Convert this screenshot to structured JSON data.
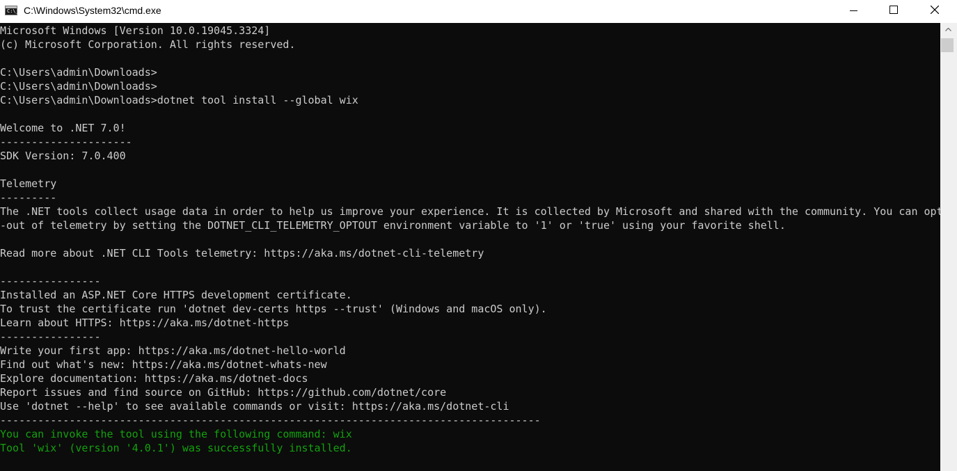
{
  "window": {
    "title": "C:\\Windows\\System32\\cmd.exe",
    "icon": "cmd-icon",
    "icon_prompt": "C:\\_"
  },
  "console": {
    "text_color": "#cccccc",
    "success_color": "#13a10e",
    "background": "#0c0c0c",
    "lines": [
      {
        "text": "Microsoft Windows [Version 10.0.19045.3324]",
        "style": "normal"
      },
      {
        "text": "(c) Microsoft Corporation. All rights reserved.",
        "style": "normal"
      },
      {
        "text": "",
        "style": "normal"
      },
      {
        "text": "C:\\Users\\admin\\Downloads>",
        "style": "normal"
      },
      {
        "text": "C:\\Users\\admin\\Downloads>",
        "style": "normal"
      },
      {
        "text": "C:\\Users\\admin\\Downloads>dotnet tool install --global wix",
        "style": "normal"
      },
      {
        "text": "",
        "style": "normal"
      },
      {
        "text": "Welcome to .NET 7.0!",
        "style": "normal"
      },
      {
        "text": "---------------------",
        "style": "normal"
      },
      {
        "text": "SDK Version: 7.0.400",
        "style": "normal"
      },
      {
        "text": "",
        "style": "normal"
      },
      {
        "text": "Telemetry",
        "style": "normal"
      },
      {
        "text": "---------",
        "style": "normal"
      },
      {
        "text": "The .NET tools collect usage data in order to help us improve your experience. It is collected by Microsoft and shared with the community. You can opt",
        "style": "normal"
      },
      {
        "text": "-out of telemetry by setting the DOTNET_CLI_TELEMETRY_OPTOUT environment variable to '1' or 'true' using your favorite shell.",
        "style": "normal"
      },
      {
        "text": "",
        "style": "normal"
      },
      {
        "text": "Read more about .NET CLI Tools telemetry: https://aka.ms/dotnet-cli-telemetry",
        "style": "normal"
      },
      {
        "text": "",
        "style": "normal"
      },
      {
        "text": "----------------",
        "style": "normal"
      },
      {
        "text": "Installed an ASP.NET Core HTTPS development certificate.",
        "style": "normal"
      },
      {
        "text": "To trust the certificate run 'dotnet dev-certs https --trust' (Windows and macOS only).",
        "style": "normal"
      },
      {
        "text": "Learn about HTTPS: https://aka.ms/dotnet-https",
        "style": "normal"
      },
      {
        "text": "----------------",
        "style": "normal"
      },
      {
        "text": "Write your first app: https://aka.ms/dotnet-hello-world",
        "style": "normal"
      },
      {
        "text": "Find out what's new: https://aka.ms/dotnet-whats-new",
        "style": "normal"
      },
      {
        "text": "Explore documentation: https://aka.ms/dotnet-docs",
        "style": "normal"
      },
      {
        "text": "Report issues and find source on GitHub: https://github.com/dotnet/core",
        "style": "normal"
      },
      {
        "text": "Use 'dotnet --help' to see available commands or visit: https://aka.ms/dotnet-cli",
        "style": "normal"
      },
      {
        "text": "--------------------------------------------------------------------------------------",
        "style": "normal"
      },
      {
        "text": "You can invoke the tool using the following command: wix",
        "style": "green"
      },
      {
        "text": "Tool 'wix' (version '4.0.1') was successfully installed.",
        "style": "green"
      }
    ]
  },
  "controls": {
    "minimize_icon": "minimize-icon",
    "maximize_icon": "maximize-icon",
    "close_icon": "close-icon",
    "scroll_up_icon": "scroll-up-arrow-icon"
  }
}
